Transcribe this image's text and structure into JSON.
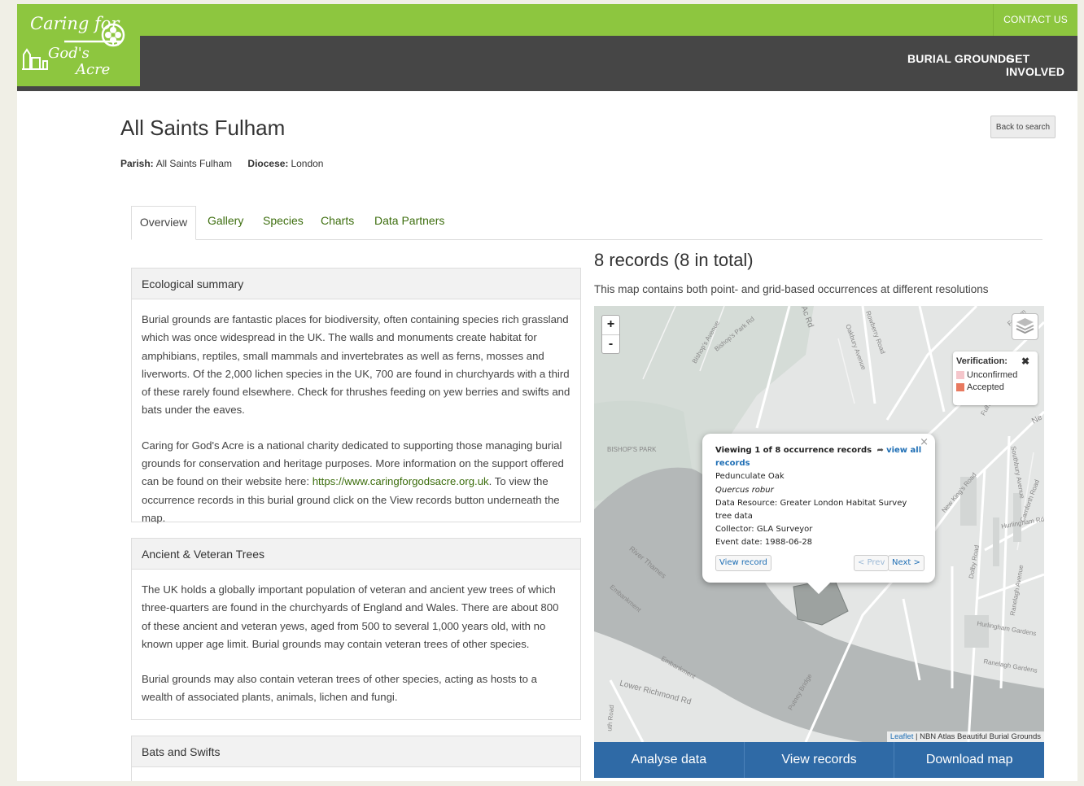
{
  "header": {
    "logo": {
      "line1": "Caring for",
      "line2": "God's",
      "line3": "Acre"
    },
    "contact_label": "CONTACT US",
    "nav": [
      "BURIAL GROUNDS",
      "GET INVOLVED"
    ]
  },
  "page": {
    "title": "All Saints Fulham",
    "back_button": "Back to search",
    "parish_label": "Parish:",
    "parish_value": "All Saints Fulham",
    "diocese_label": "Diocese:",
    "diocese_value": "London"
  },
  "tabs": [
    "Overview",
    "Gallery",
    "Species",
    "Charts",
    "Data Partners"
  ],
  "panels": {
    "eco": {
      "title": "Ecological summary",
      "p1": "Burial grounds are fantastic places for biodiversity, often containing species rich grassland which was once widespread in the UK. The walls and monuments create habitat for amphibians, reptiles, small mammals and invertebrates as well as ferns, mosses and liverworts. Of the 2,000 lichen species in the UK, 700 are found in churchyards with a third of these rarely found elsewhere. Check for thrushes feeding on yew berries and swifts and bats under the eaves.",
      "p2_a": "Caring for God's Acre is a national charity dedicated to supporting those managing burial grounds for conservation and heritage purposes. More information on the support offered can be found on their website here: ",
      "p2_link": "https://www.caringforgodsacre.org.uk",
      "p2_b": ". To view the occurrence records in this burial ground click on the View records button underneath the map."
    },
    "trees": {
      "title": "Ancient & Veteran Trees",
      "p1": "The UK holds a globally important population of veteran and ancient yew trees of which three-quarters are found in the churchyards of England and Wales. There are about 800 of these ancient and veteran yews, aged from 500 to several 1,000 years old, with no known upper age limit. Burial grounds may contain veteran trees of other species.",
      "p2": "Burial grounds may also contain veteran trees of other species, acting as hosts to a wealth of associated plants, animals, lichen and fungi."
    },
    "bats": {
      "title": "Bats and Swifts"
    }
  },
  "records": {
    "title": "8 records (8 in total)",
    "subtitle": "This map contains both point- and grid-based occurrences at different resolutions"
  },
  "map": {
    "zoom_in": "+",
    "zoom_out": "-",
    "legend": {
      "title": "Verification:",
      "close": "✖",
      "items": [
        {
          "label": "Unconfirmed",
          "color": "#f5c6cb"
        },
        {
          "label": "Accepted",
          "color": "#e8795f"
        }
      ]
    },
    "popup": {
      "viewing": "Viewing 1 of 8 occurrence records",
      "view_all_arrow": "➦",
      "view_all": "view all records",
      "common_name": "Pedunculate Oak",
      "sci_name": "Quercus robur",
      "resource": "Data Resource: Greater London Habitat Survey tree data",
      "collector": "Collector: GLA Surveyor",
      "event_date": "Event date: 1988-06-28",
      "view_record": "View record",
      "prev": "< Prev",
      "next": "Next >",
      "close": "×"
    },
    "labels": {
      "park": "BISHOP'S PARK",
      "river": "River Thames",
      "lower_richmond": "Lower Richmond Rd",
      "putney": "Putney Bridge",
      "kings_road": "New King's Road",
      "fulham": "Fulham",
      "hurlingham": "Hurlingham Gardens",
      "ranelagh": "Ranelagh Gardens",
      "embankment": "Embankment",
      "bishops_park_rd": "Bishop's Park Rd",
      "bishops_ave": "Bishop's Avenue",
      "oakbury": "Oakbury Avenue",
      "rowberry": "Rowberry Road",
      "ac_rd": "Ac Rd",
      "fulham_park": "Fulham Park",
      "ne": "Ne",
      "southbury": "Southbury Avenue",
      "carnforth": "Carnforth Road",
      "dolby": "Dolby Road",
      "hurlingham_rd": "Hurlingham Rd",
      "ranelagh_av": "Ranelagh Avenue",
      "sth_road": "uth Road",
      "embankment2": "Embankment"
    },
    "attribution_link": "Leaflet",
    "attribution_text": "| NBN Atlas Beautiful Burial Grounds"
  },
  "actions": [
    "Analyse data",
    "View records",
    "Download map"
  ],
  "colors": {
    "brand_green": "#8dc63f",
    "nav_dark": "#464646",
    "link_green": "#3d6e0e",
    "action_blue": "#2f6aa6"
  }
}
